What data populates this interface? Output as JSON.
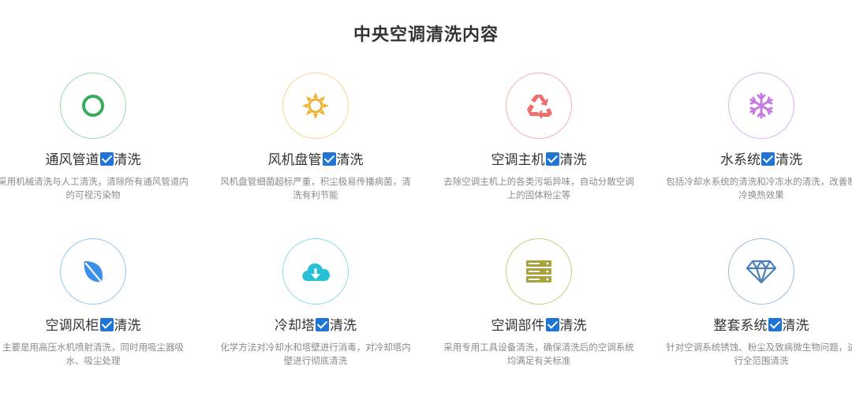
{
  "title": "中央空调清洗内容",
  "items": [
    {
      "name_part": "通风管道",
      "suffix": "清洗",
      "desc": "采用机械清洗与人工清洗，清除所有通风管道内的可视污染物",
      "icon": "ring-icon",
      "color": "#3aaa5c"
    },
    {
      "name_part": "风机盘管",
      "suffix": "清洗",
      "desc": "风机盘管细菌超标严重，积尘极易传播病菌，清洗有利节能",
      "icon": "sun-icon",
      "color": "#f0b030"
    },
    {
      "name_part": "空调主机",
      "suffix": "清洗",
      "desc": "去除空调主机上的各类污垢异味，自动分散空调上的固体粉尘等",
      "icon": "recycle-icon",
      "color": "#ef6f6f"
    },
    {
      "name_part": "水系统",
      "suffix": "清洗",
      "desc": "包括冷却水系统的清洗和冷冻水的清洗，改善制冷换热效果",
      "icon": "snowflake-icon",
      "color": "#c57be0"
    },
    {
      "name_part": "空调风柜",
      "suffix": "清洗",
      "desc": "主要是用高压水机喷射清洗，同时用吸尘器吸水、吸尘处理",
      "icon": "leaf-icon",
      "color": "#3a8fe8"
    },
    {
      "name_part": "冷却塔",
      "suffix": "清洗",
      "desc": "化学方法对冷却水和塔壁进行消毒，对冷却塔内壁进行彻底清洗",
      "icon": "cloud-download-icon",
      "color": "#26c0d6"
    },
    {
      "name_part": "空调部件",
      "suffix": "清洗",
      "desc": "采用专用工具设备清洗，确保清洗后的空调系统均满足有关标准",
      "icon": "server-icon",
      "color": "#a9a23a"
    },
    {
      "name_part": "整套系统",
      "suffix": "清洗",
      "desc": "针对空调系统锈蚀、粉尘及致病微生物问题，进行全范围清洗",
      "icon": "diamond-icon",
      "color": "#4a7fb8"
    }
  ]
}
